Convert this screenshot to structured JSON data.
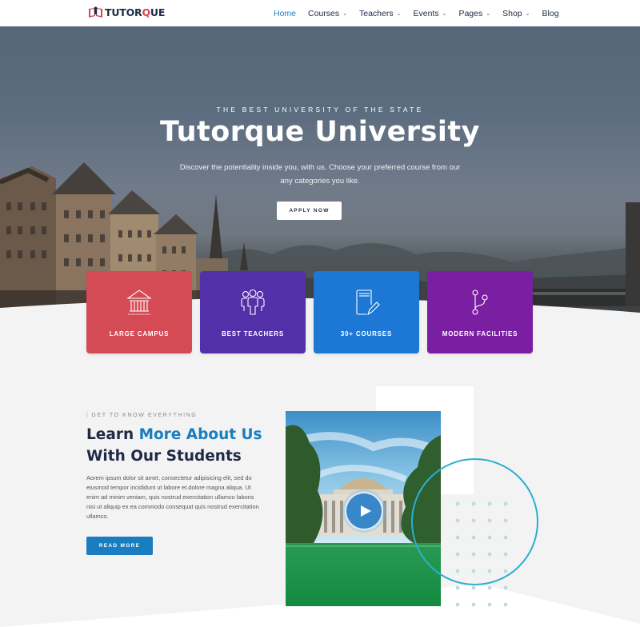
{
  "header": {
    "logo": {
      "text_before": "TUTOR",
      "text_q": "Q",
      "text_after": "UE",
      "icon": "book-shield-logo-icon"
    },
    "nav": [
      {
        "label": "Home",
        "active": true,
        "has_dropdown": false
      },
      {
        "label": "Courses",
        "active": false,
        "has_dropdown": true
      },
      {
        "label": "Teachers",
        "active": false,
        "has_dropdown": true
      },
      {
        "label": "Events",
        "active": false,
        "has_dropdown": true
      },
      {
        "label": "Pages",
        "active": false,
        "has_dropdown": true
      },
      {
        "label": "Shop",
        "active": false,
        "has_dropdown": true
      },
      {
        "label": "Blog",
        "active": false,
        "has_dropdown": false
      }
    ],
    "caret": "⌄"
  },
  "hero": {
    "kicker": "THE BEST UNIVERSITY OF THE STATE",
    "title": "Tutorque University",
    "subtitle": "Discover the potentiality inside you, with us. Choose your preferred course from our any categories  you like.",
    "cta_label": "APPLY NOW"
  },
  "features": [
    {
      "label": "LARGE CAMPUS",
      "icon": "campus-building-icon",
      "color": "#d44a55"
    },
    {
      "label": "BEST TEACHERS",
      "icon": "teachers-group-icon",
      "color": "#5230a8"
    },
    {
      "label": "30+ COURSES",
      "icon": "book-pencil-icon",
      "color": "#1c78d4"
    },
    {
      "label": "MODERN FACILITIES",
      "icon": "branch-nodes-icon",
      "color": "#7a1fa2"
    }
  ],
  "about": {
    "kicker": "GET TO KNOW EVERYTHING",
    "title_part1": "Learn ",
    "title_accent": "More About Us",
    "title_line2": "With Our Students",
    "body": "Aorem ipsum dolor sit amet, consectetur adipisicing elit, sed do eiusmod tempor incididunt ut labore et.dolore magna aliqua. Ut enim ad minim veniam, quis nostrud exercitation ullamco laboris nisi ut aliquip ex ea commodo consequat quis nostrud exercitation ullamco.",
    "button_label": "READ MORE",
    "video": {
      "icon": "play-icon"
    }
  },
  "colors": {
    "brand_dark": "#1e2a44",
    "accent_blue": "#1a7dc0",
    "logo_red": "#d64550",
    "ring": "#2bafd0"
  }
}
